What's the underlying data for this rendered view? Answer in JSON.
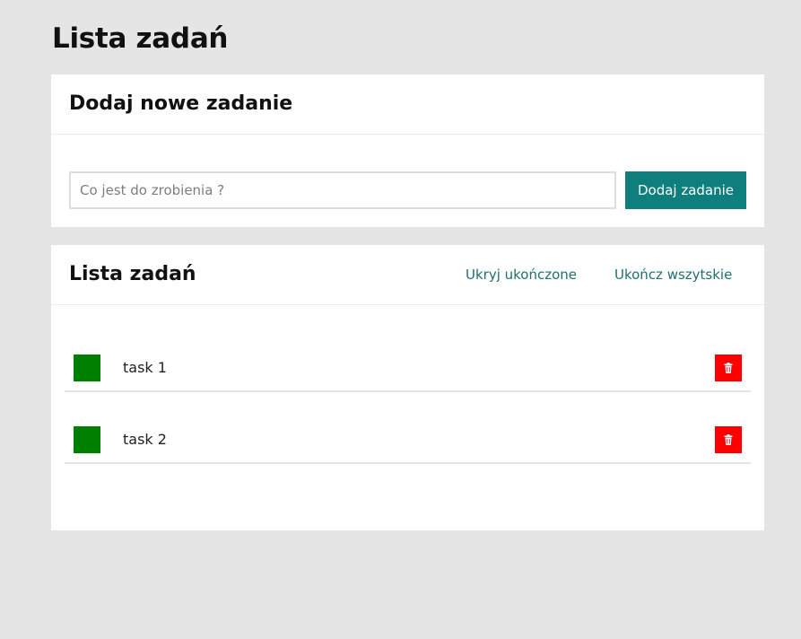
{
  "page": {
    "title": "Lista zadań"
  },
  "add_card": {
    "title": "Dodaj nowe zadanie",
    "input_placeholder": "Co jest do zrobienia ?",
    "input_value": "",
    "button_label": "Dodaj zadanie"
  },
  "list_card": {
    "title": "Lista zadań",
    "hide_completed_label": "Ukryj ukończone",
    "complete_all_label": "Ukończ wszytskie",
    "tasks": [
      {
        "label": "task 1",
        "status_icon": "checkbox-square",
        "delete_icon": "trash-icon"
      },
      {
        "label": "task 2",
        "status_icon": "checkbox-square",
        "delete_icon": "trash-icon"
      }
    ]
  },
  "colors": {
    "background": "#e5e5e5",
    "accent": "#0e7f7d",
    "link": "#1f6f74",
    "task_status": "#008000",
    "delete": "#ff0000"
  }
}
